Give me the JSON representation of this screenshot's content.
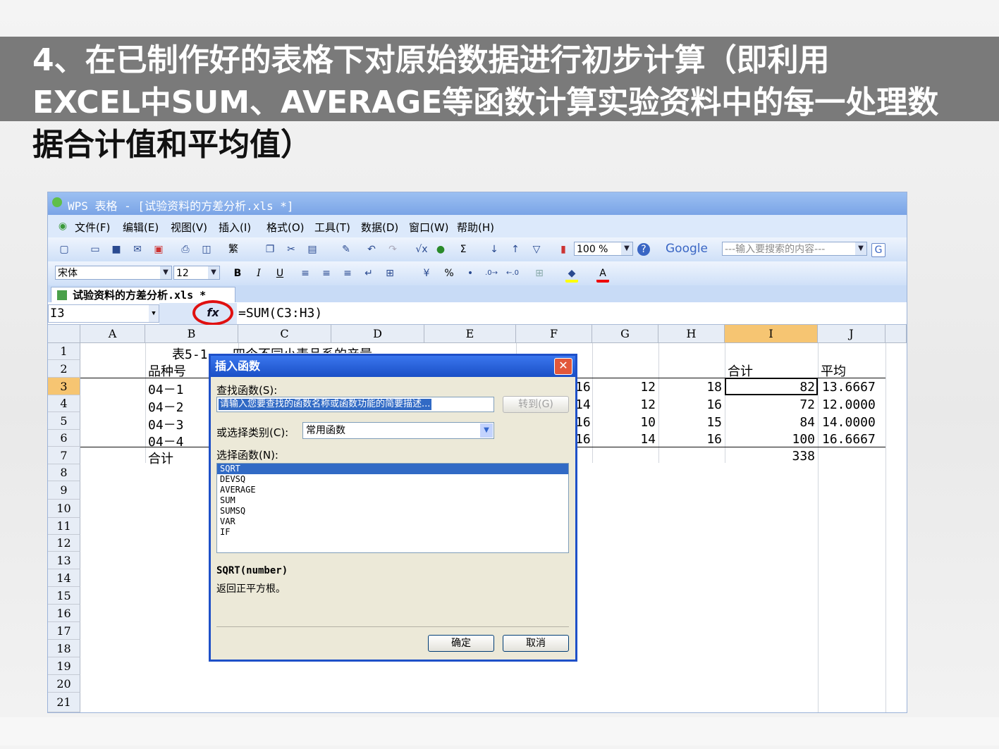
{
  "slide": {
    "title_lines": [
      "4、在已制作好的表格下对原始数据进行初步计算（即利用",
      "EXCEL中SUM、AVERAGE等函数计算实验资料中的每一处理数",
      "据合计值和平均值）"
    ]
  },
  "window": {
    "title": "WPS 表格 - [试验资料的方差分析.xls *]"
  },
  "menu": [
    "文件(F)",
    "编辑(E)",
    "视图(V)",
    "插入(I)",
    "格式(O)",
    "工具(T)",
    "数据(D)",
    "窗口(W)",
    "帮助(H)"
  ],
  "toolbar": {
    "zoom": "100 %",
    "search_placeholder": "---输入要搜索的内容---",
    "google_label": "Google",
    "font_name": "宋体",
    "font_size": "12",
    "bold": "B",
    "italic": "I",
    "underline": "U",
    "percent": "%",
    "traditional": "繁",
    "sigma": "Σ",
    "font_color_letter": "A"
  },
  "sheet_tab": "试验资料的方差分析.xls *",
  "formula_bar": {
    "cell_ref": "I3",
    "fx": "fx",
    "formula": "=SUM(C3:H3)"
  },
  "columns": [
    "A",
    "B",
    "C",
    "D",
    "E",
    "F",
    "G",
    "H",
    "I",
    "J"
  ],
  "rows": [
    "1",
    "2",
    "3",
    "4",
    "5",
    "6",
    "7",
    "8",
    "9",
    "10",
    "11",
    "12",
    "13",
    "14",
    "15",
    "16",
    "17",
    "18",
    "19",
    "20",
    "21"
  ],
  "cells": {
    "title_partial": "表5-1",
    "title_tail": "四个不同小麦品系的产量",
    "b2": "品种号",
    "i2": "合计",
    "j2": "平均",
    "b3": "04－1",
    "b4": "04－2",
    "b5": "04－3",
    "b6": "04－4",
    "b7": "合计",
    "f": [
      "16",
      "14",
      "16",
      "16"
    ],
    "g": [
      "12",
      "12",
      "10",
      "14"
    ],
    "h": [
      "18",
      "16",
      "15",
      "16"
    ],
    "i": [
      "82",
      "72",
      "84",
      "100",
      "338"
    ],
    "j": [
      "13.6667",
      "12.0000",
      "14.0000",
      "16.6667"
    ]
  },
  "dialog": {
    "title": "插入函数",
    "search_label": "查找函数(S):",
    "search_placeholder": "请输入您要查找的函数名称或函数功能的简要描述...",
    "goto_label": "转到(G)",
    "category_label": "或选择类别(C):",
    "category_value": "常用函数",
    "select_label": "选择函数(N):",
    "functions": [
      "SQRT",
      "DEVSQ",
      "AVERAGE",
      "SUM",
      "SUMSQ",
      "VAR",
      "IF"
    ],
    "signature": "SQRT(number)",
    "description": "返回正平方根。",
    "ok_label": "确定",
    "cancel_label": "取消",
    "close_label": "✕"
  }
}
